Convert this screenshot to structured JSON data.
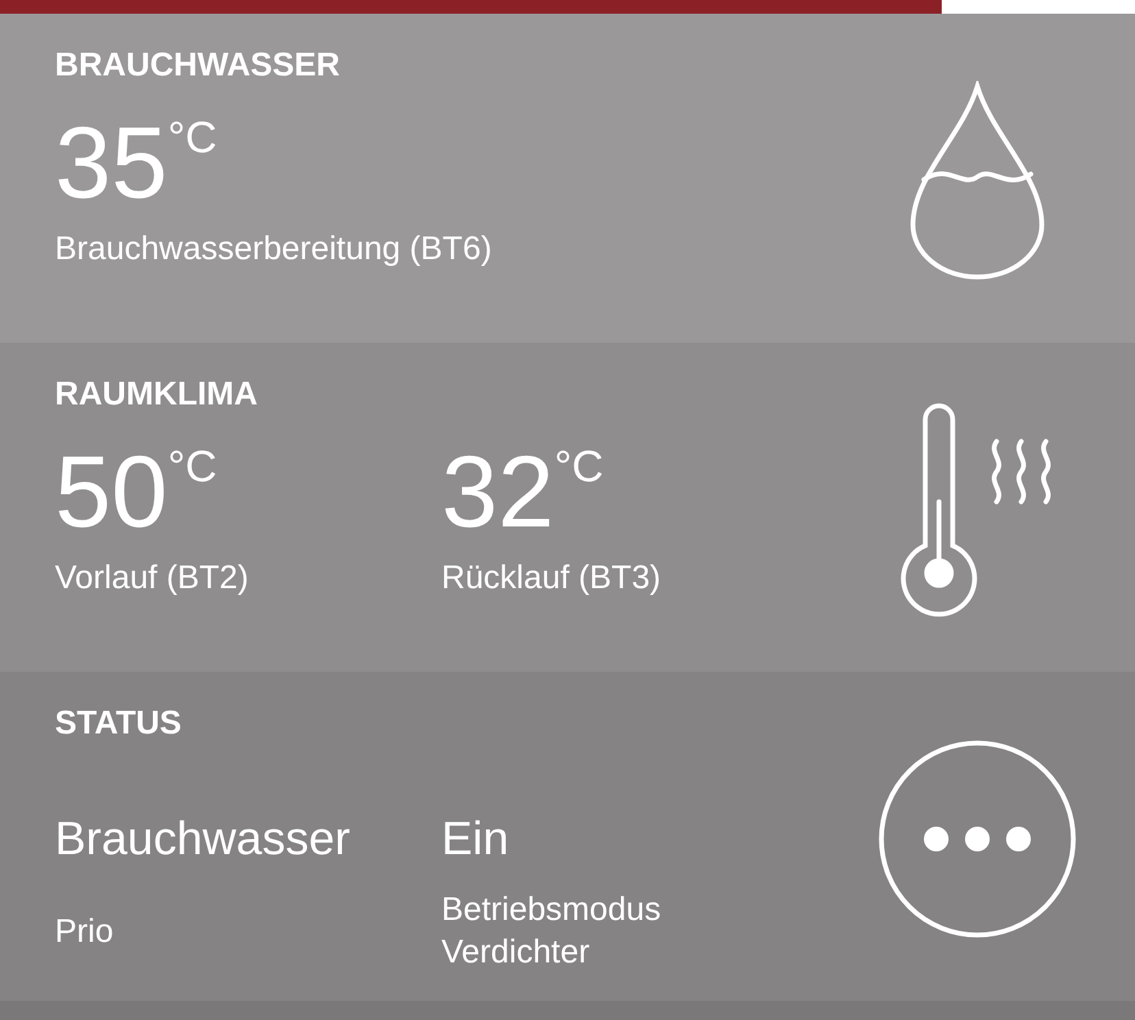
{
  "progress": {
    "level": 0.83
  },
  "sections": [
    {
      "kind": "temperature",
      "title": "BRAUCHWASSER",
      "items": [
        {
          "value": "35",
          "unit": "°C",
          "label": "Brauchwasserbereitung (BT6)"
        }
      ]
    },
    {
      "kind": "temperature",
      "title": "RAUMKLIMA",
      "items": [
        {
          "value": "50",
          "unit": "°C",
          "label": "Vorlauf (BT2)"
        },
        {
          "value": "32",
          "unit": "°C",
          "label": "Rücklauf (BT3)"
        }
      ]
    },
    {
      "kind": "status",
      "title": "STATUS",
      "items": [
        {
          "value": "Brauchwasser",
          "label": "Prio"
        },
        {
          "value": "Ein",
          "label": "Betriebsmodus Verdichter"
        }
      ]
    }
  ]
}
